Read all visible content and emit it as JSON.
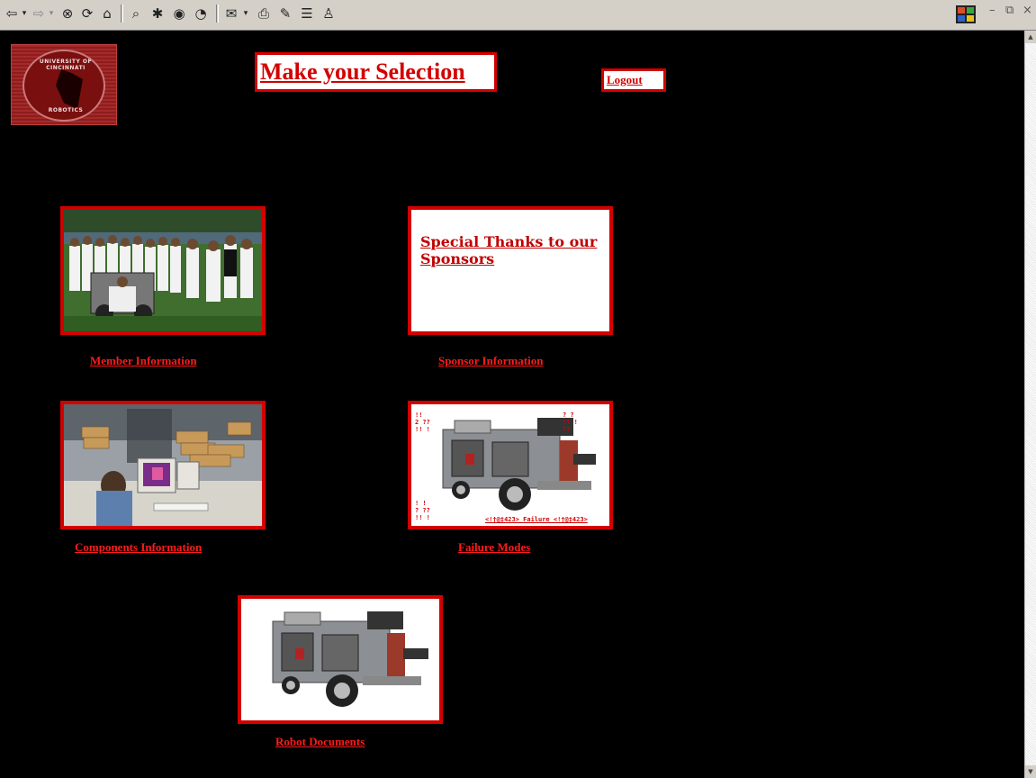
{
  "page": {
    "title": "Make your Selection",
    "logout_label": "Logout"
  },
  "logo": {
    "top_text": "UNIVERSITY OF CINCINNATI",
    "bottom_text": "ROBOTICS"
  },
  "tiles": {
    "member": {
      "link": "Member Information"
    },
    "sponsor": {
      "link": "Sponsor Information",
      "image_text": "Special Thanks to our Sponsors"
    },
    "components": {
      "link": "Components Information"
    },
    "failure": {
      "link": "Failure Modes",
      "overlay_top_left": "!!\n2 ??\n!! !",
      "overlay_top_right": "? ?\n!! !\n??",
      "overlay_bottom_left": "! !\n? ??\n!! !",
      "overlay_caption": "<!†@‡423> Failure <!†@‡423>"
    },
    "documents": {
      "link": "Robot Documents"
    }
  },
  "colors": {
    "background": "#000000",
    "accent": "#d40000",
    "link": "#ff1a1a"
  }
}
